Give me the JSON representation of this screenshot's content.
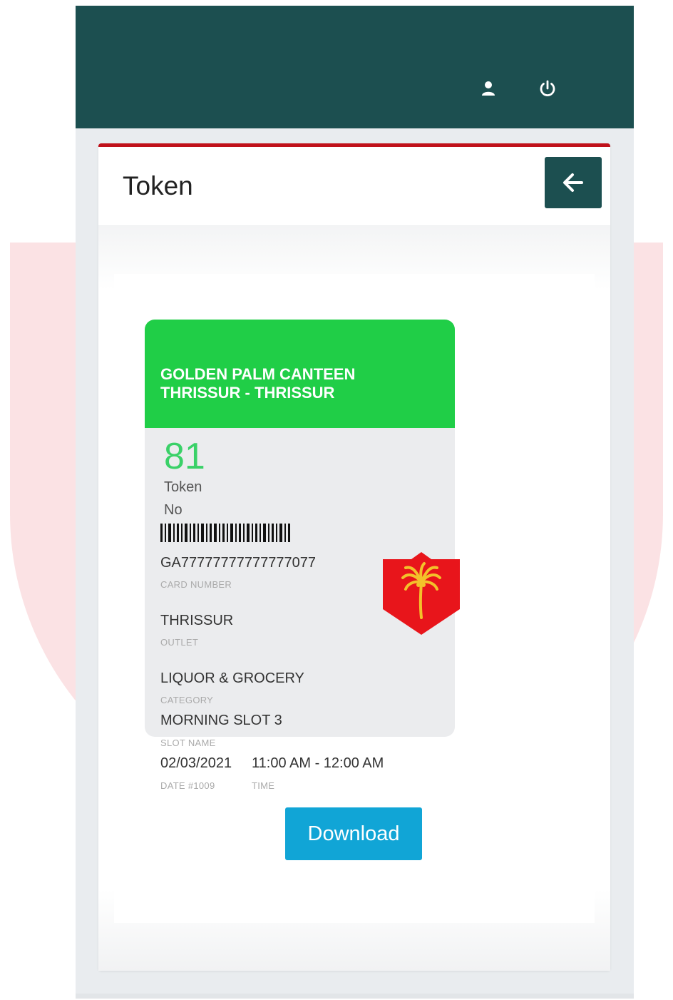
{
  "header": {
    "title": "Token",
    "back_icon": "arrow-left-icon",
    "user_icon": "user-icon",
    "power_icon": "power-icon"
  },
  "card": {
    "canteen_line1": "GOLDEN PALM CANTEEN",
    "canteen_line2": "THRISSUR - THRISSUR",
    "token_number": "81",
    "token_label_line1": "Token",
    "token_label_line2": "No",
    "card_number": "GA77777777777777077",
    "card_number_label": "CARD NUMBER",
    "outlet": "THRISSUR",
    "outlet_label": "OUTLET",
    "category": "LIQUOR & GROCERY",
    "category_label": "CATEGORY",
    "slot_name": "MORNING SLOT 3",
    "slot_name_label": "SLOT NAME",
    "date": "02/03/2021",
    "date_label": "DATE #1009",
    "time": "11:00 AM - 12:00 AM",
    "time_label": "TIME"
  },
  "actions": {
    "download_label": "Download"
  },
  "colors": {
    "topbar": "#1c4f50",
    "accent_red": "#c0111a",
    "card_header_green": "#20ce47",
    "token_number_green": "#3ad168",
    "download_blue": "#11a5d6"
  }
}
